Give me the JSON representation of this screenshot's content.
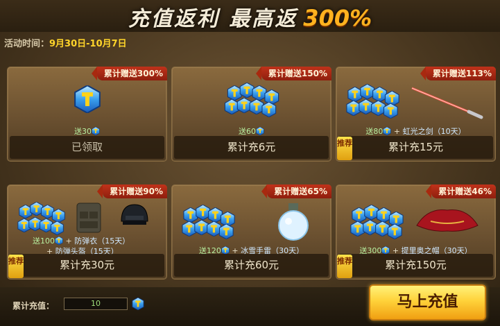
{
  "header": {
    "title_main": "充值返利 最高返",
    "title_percent": "300%"
  },
  "period": {
    "label": "活动时间：",
    "value": "9月30日-10月7日"
  },
  "cards": [
    {
      "ribbon": "累计赠送300%",
      "reward_amount": "送30",
      "items": [],
      "button": "已领取",
      "recommended": false,
      "claimed": true
    },
    {
      "ribbon": "累计赠送150%",
      "reward_amount": "送60",
      "items": [],
      "button": "累计充6元",
      "recommended": false,
      "claimed": false
    },
    {
      "ribbon": "累计赠送113%",
      "reward_amount": "送80",
      "items": [
        "虹光之剑（10天）"
      ],
      "button": "累计充15元",
      "recommended": true,
      "claimed": false
    },
    {
      "ribbon": "累计赠送90%",
      "reward_amount": "送100",
      "items": [
        "防弹衣（15天）",
        "防弹头盔（15天）"
      ],
      "button": "累计充30元",
      "recommended": true,
      "claimed": false
    },
    {
      "ribbon": "累计赠送65%",
      "reward_amount": "送120",
      "items": [
        "冰雪手雷（30天）"
      ],
      "button": "累计充60元",
      "recommended": false,
      "claimed": false
    },
    {
      "ribbon": "累计赠送46%",
      "reward_amount": "送300",
      "items": [
        "提里奥之帽（30天）"
      ],
      "button": "累计充150元",
      "recommended": true,
      "claimed": false
    }
  ],
  "badge_text": "推荐",
  "footer": {
    "total_label": "累计充值：",
    "total_value": "10",
    "recharge_button": "马上充值"
  },
  "colors": {
    "ribbon": "#b02a14",
    "coin": "#2aa8f0",
    "button": "#ffd23a",
    "accent": "#ffb21f"
  }
}
